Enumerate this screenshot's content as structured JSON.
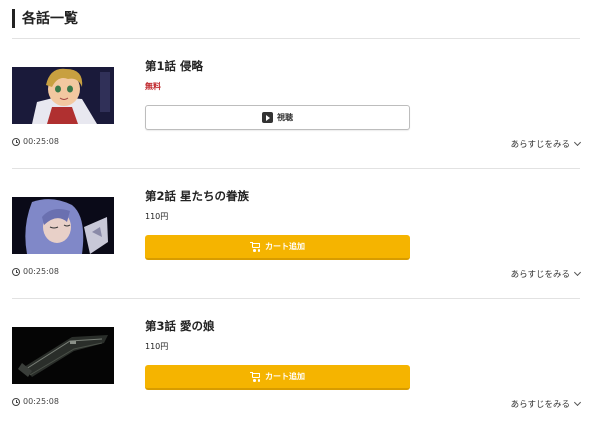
{
  "section": {
    "title": "各話一覧"
  },
  "episodes": [
    {
      "title": "第1話 侵略",
      "price": "無料",
      "free": true,
      "button_label": "視聴",
      "duration": "00:25:08",
      "synopsis_label": "あらすじをみる"
    },
    {
      "title": "第2話 星たちの眷族",
      "price": "110円",
      "free": false,
      "button_label": "カート追加",
      "duration": "00:25:08",
      "synopsis_label": "あらすじをみる"
    },
    {
      "title": "第3話 愛の娘",
      "price": "110円",
      "free": false,
      "button_label": "カート追加",
      "duration": "00:25:08",
      "synopsis_label": "あらすじをみる"
    }
  ],
  "colors": {
    "free_price": "#c0282d",
    "cart_button": "#f5b400",
    "accent_bar": "#222222"
  },
  "icons": [
    "clock-icon",
    "play-icon",
    "cart-icon",
    "chevron-down-icon"
  ]
}
